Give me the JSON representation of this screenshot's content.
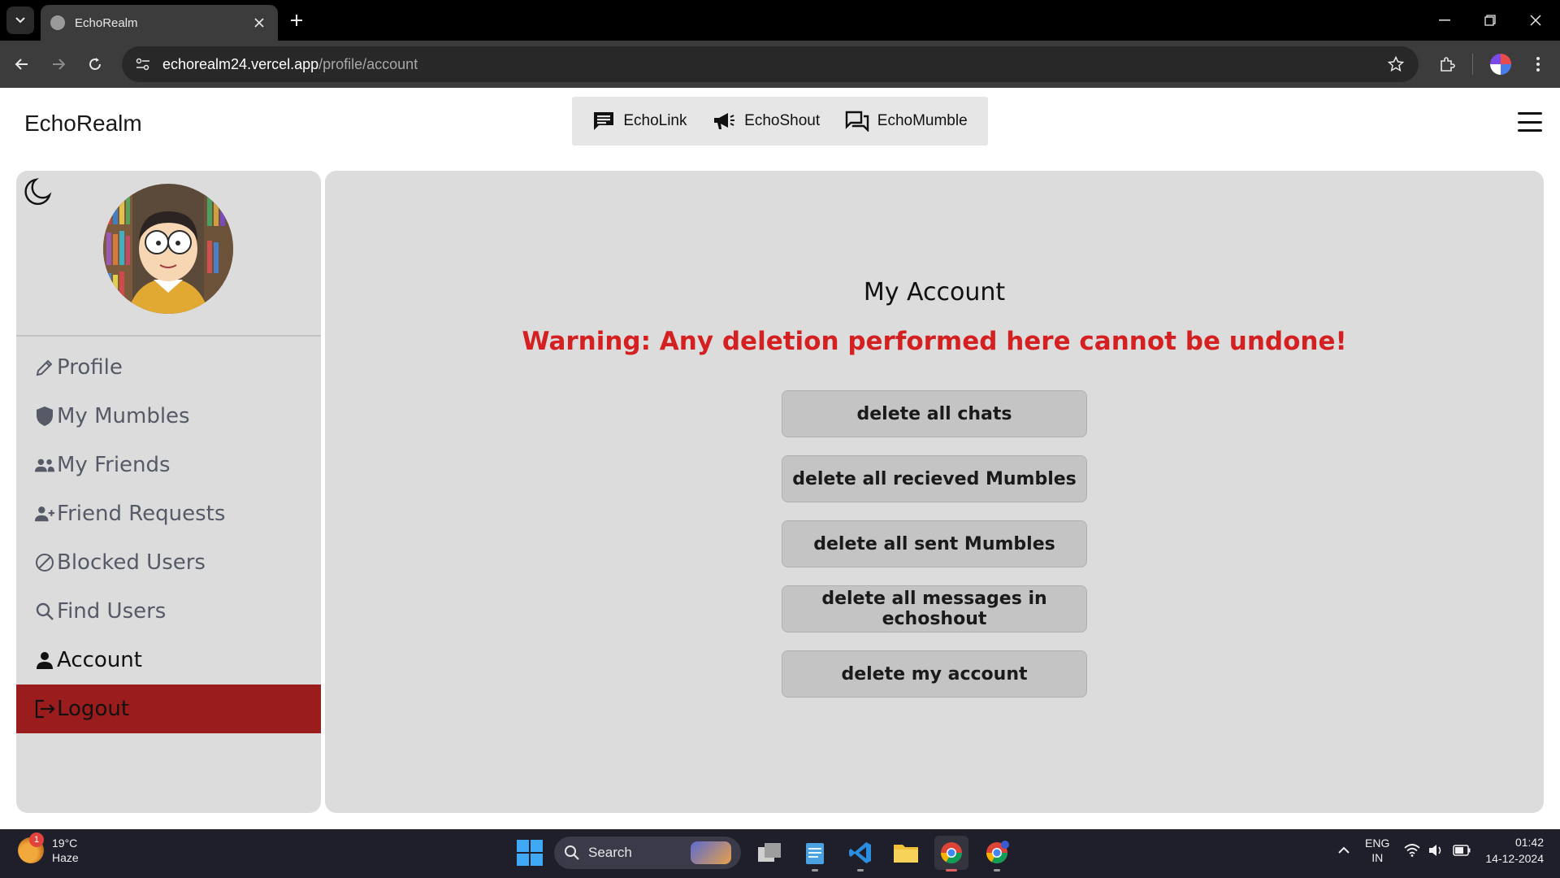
{
  "browser": {
    "tab_title": "EchoRealm",
    "url_domain": "echorealm24.vercel.app",
    "url_path": "/profile/account"
  },
  "app": {
    "brand": "EchoRealm",
    "topnav": [
      {
        "label": "EchoLink",
        "icon": "chat-icon"
      },
      {
        "label": "EchoShout",
        "icon": "megaphone-icon"
      },
      {
        "label": "EchoMumble",
        "icon": "forum-icon"
      }
    ]
  },
  "sidebar": {
    "items": [
      {
        "label": "Profile",
        "icon": "pencil-icon"
      },
      {
        "label": "My Mumbles",
        "icon": "shield-icon"
      },
      {
        "label": "My Friends",
        "icon": "people-icon"
      },
      {
        "label": "Friend Requests",
        "icon": "person-add-icon"
      },
      {
        "label": "Blocked Users",
        "icon": "blocked-icon"
      },
      {
        "label": "Find Users",
        "icon": "search-icon"
      },
      {
        "label": "Account",
        "icon": "person-icon",
        "active": true
      },
      {
        "label": "Logout",
        "icon": "logout-icon"
      }
    ]
  },
  "main": {
    "title": "My Account",
    "warning": "Warning: Any deletion performed here cannot be undone!",
    "actions": [
      "delete all chats",
      "delete all recieved Mumbles",
      "delete all sent Mumbles",
      "delete all messages in echoshout",
      "delete my account"
    ]
  },
  "taskbar": {
    "weather_temp": "19°C",
    "weather_desc": "Haze",
    "weather_badge": "1",
    "search_label": "Search",
    "lang_top": "ENG",
    "lang_bottom": "IN",
    "time": "01:42",
    "date": "14-12-2024"
  },
  "colors": {
    "logout_bg": "#9b1c1c",
    "warning": "#d42020",
    "panel_bg": "#dcdcdc"
  }
}
